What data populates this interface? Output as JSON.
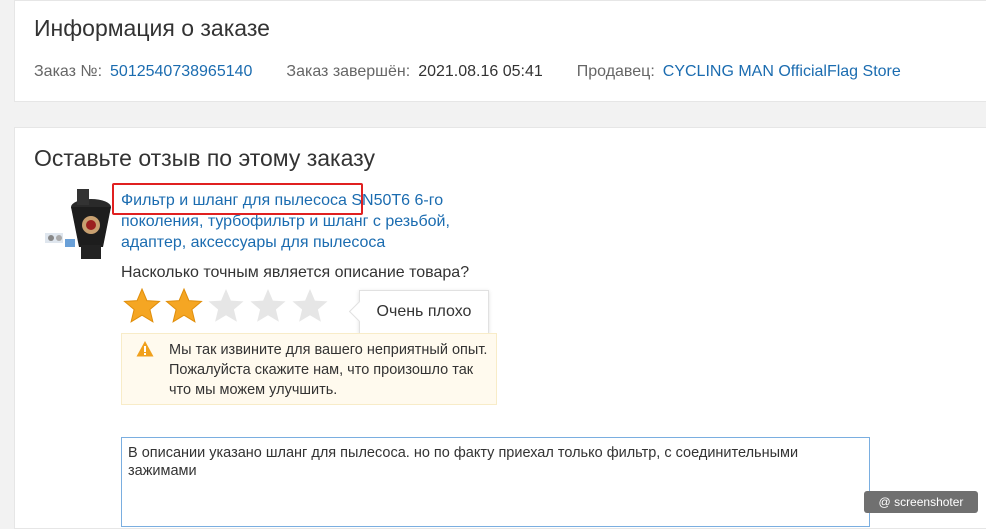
{
  "order_info": {
    "title": "Информация о заказе",
    "order_label": "Заказ №:",
    "order_number": "5012540738965140",
    "completed_label": "Заказ завершён:",
    "completed_date": "2021.08.16 05:41",
    "seller_label": "Продавец:",
    "seller_name": "CYCLING MAN OfficialFlag Store"
  },
  "review": {
    "title": "Оставьте отзыв по этому заказу",
    "product_title": "Фильтр и шланг для пылесоса SN50T6 6-го поколения, турбофильтр и шланг с резьбой, адаптер, аксессуары для пылесоса",
    "question": "Насколько точным является описание товара?",
    "rating": 2,
    "rating_max": 5,
    "rating_tooltip": "Очень плохо",
    "warning_text": "Мы так извините для вашего неприятный опыт. Пожалуйста скажите нам, что произошло так что мы можем улучшить.",
    "comment_value": "В описании указано шланг для пылесоса. но по факту приехал только фильтр, с соединительными зажимами"
  },
  "icons": {
    "warning": "warning-triangle-icon",
    "star_filled": "star-filled-icon",
    "star_empty": "star-empty-icon"
  },
  "colors": {
    "link": "#1b6cb0",
    "star_filled": "#f5a623",
    "star_empty": "#e6e6e6",
    "highlight": "#e02020",
    "warning_bg": "#fffaee"
  },
  "watermark": "@ screenshoter"
}
